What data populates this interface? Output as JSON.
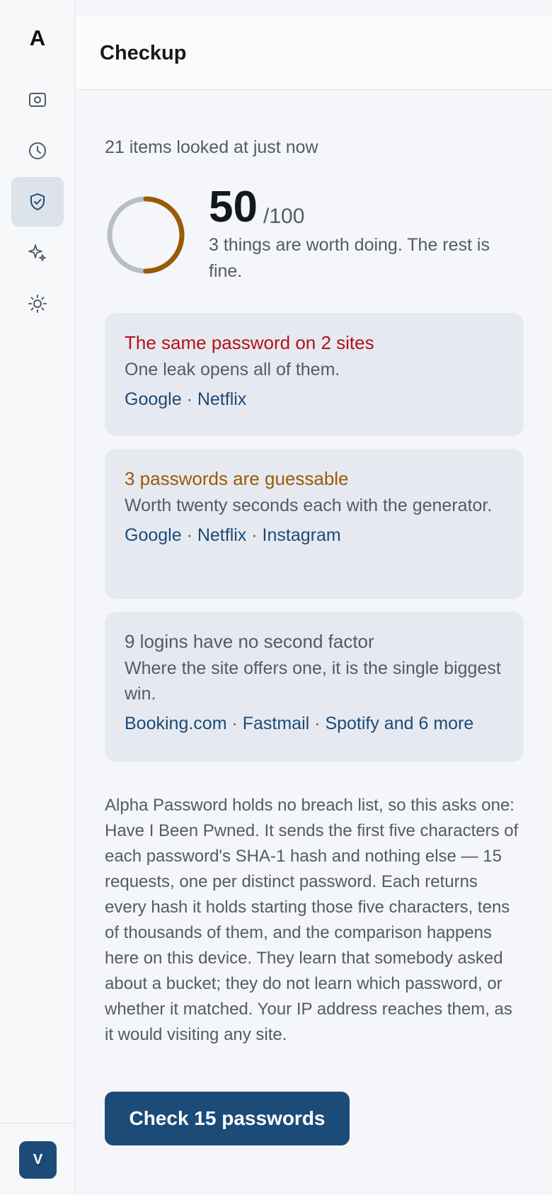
{
  "app": {
    "logo_letter": "A",
    "page_title": "Checkup",
    "user_initial": "V"
  },
  "sidebar": {
    "items": [
      {
        "icon": "photo-icon",
        "active": false
      },
      {
        "icon": "clock-icon",
        "active": false
      },
      {
        "icon": "shield-check-icon",
        "active": true
      },
      {
        "icon": "sparkles-icon",
        "active": false
      },
      {
        "icon": "sun-icon",
        "active": false
      }
    ]
  },
  "checkup": {
    "status_text": "21 items looked at just now",
    "score": "50",
    "score_max": "/100",
    "score_fraction": 0.5,
    "summary": "3 things are worth doing. The rest is fine.",
    "issues": [
      {
        "title": "The same password on 2 sites",
        "description": "One leak opens all of them.",
        "links": [
          "Google",
          "Netflix"
        ],
        "severity_color": "#b3101e"
      },
      {
        "title": "3 passwords are guessable",
        "description": "Worth twenty seconds each with the generator.",
        "links": [
          "Google",
          "Netflix",
          "Instagram"
        ],
        "severity_color": "#9b5a07"
      },
      {
        "title": "9 logins have no second factor",
        "description": "Where the site offers one, it is the single biggest win.",
        "links": [
          "Booking.com",
          "Fastmail",
          "Spotify and 6 more"
        ],
        "severity_color": "#545b64"
      }
    ],
    "explanation": "Alpha Password holds no breach list, so this asks one: Have I Been Pwned. It sends the first five characters of each password's SHA-1 hash and nothing else — 15 requests, one per distinct password. Each returns every hash it holds starting those five characters, tens of thousands of them, and the comparison happens here on this device. They learn that somebody asked about a bucket; they do not learn which password, or whether it matched. Your IP address reaches them, as it would visiting any site.",
    "check_button_label": "Check 15 passwords"
  },
  "colors": {
    "accent": "#1d4b78",
    "ring_track": "#b9bec6",
    "ring_progress": "#9b5a07",
    "danger": "#b3101e"
  }
}
